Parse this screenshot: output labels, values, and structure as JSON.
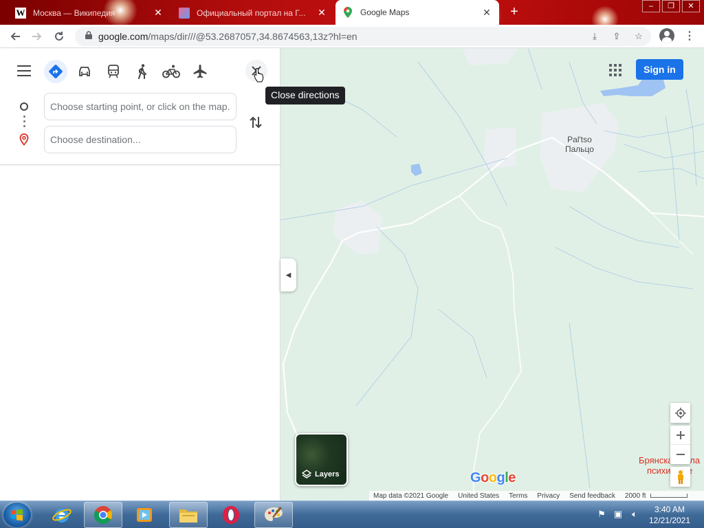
{
  "browser": {
    "tabs": [
      {
        "title": "Москва — Википедия",
        "favicon": "wikipedia-icon",
        "active": false
      },
      {
        "title": "Официальный портал на Г...",
        "favicon": "image-favicon",
        "active": false
      },
      {
        "title": "Google Maps",
        "favicon": "google-maps-icon",
        "active": true
      }
    ],
    "address": {
      "host": "google.com",
      "path": "/maps/dir///@53.2687057,34.8674563,13z?hl=en"
    }
  },
  "directions_panel": {
    "modes": [
      {
        "name": "best-route",
        "selected": true
      },
      {
        "name": "driving",
        "selected": false
      },
      {
        "name": "transit",
        "selected": false
      },
      {
        "name": "walking",
        "selected": false
      },
      {
        "name": "cycling",
        "selected": false
      },
      {
        "name": "flights",
        "selected": false
      }
    ],
    "start_placeholder": "Choose starting point, or click on the map...",
    "destination_placeholder": "Choose destination...",
    "tooltip": "Close directions"
  },
  "map": {
    "sign_in": "Sign in",
    "place_label_latin": "Pal'tso",
    "place_label_cyrillic": "Пальцо",
    "red_label_line1": "Брянская обла",
    "red_label_line2": "психи...ече",
    "layers_label": "Layers",
    "google_logo": "Google",
    "footer": {
      "map_data": "Map data ©2021 Google",
      "country": "United States",
      "terms": "Terms",
      "privacy": "Privacy",
      "feedback": "Send feedback",
      "scale": "2000 ft"
    }
  },
  "taskbar": {
    "clock_time": "3:40 AM",
    "clock_date": "12/21/2021"
  },
  "colors": {
    "accent_blue": "#1a73e8",
    "map_land": "#e1f0e6",
    "tab_strip_red": "#b30d0d"
  }
}
